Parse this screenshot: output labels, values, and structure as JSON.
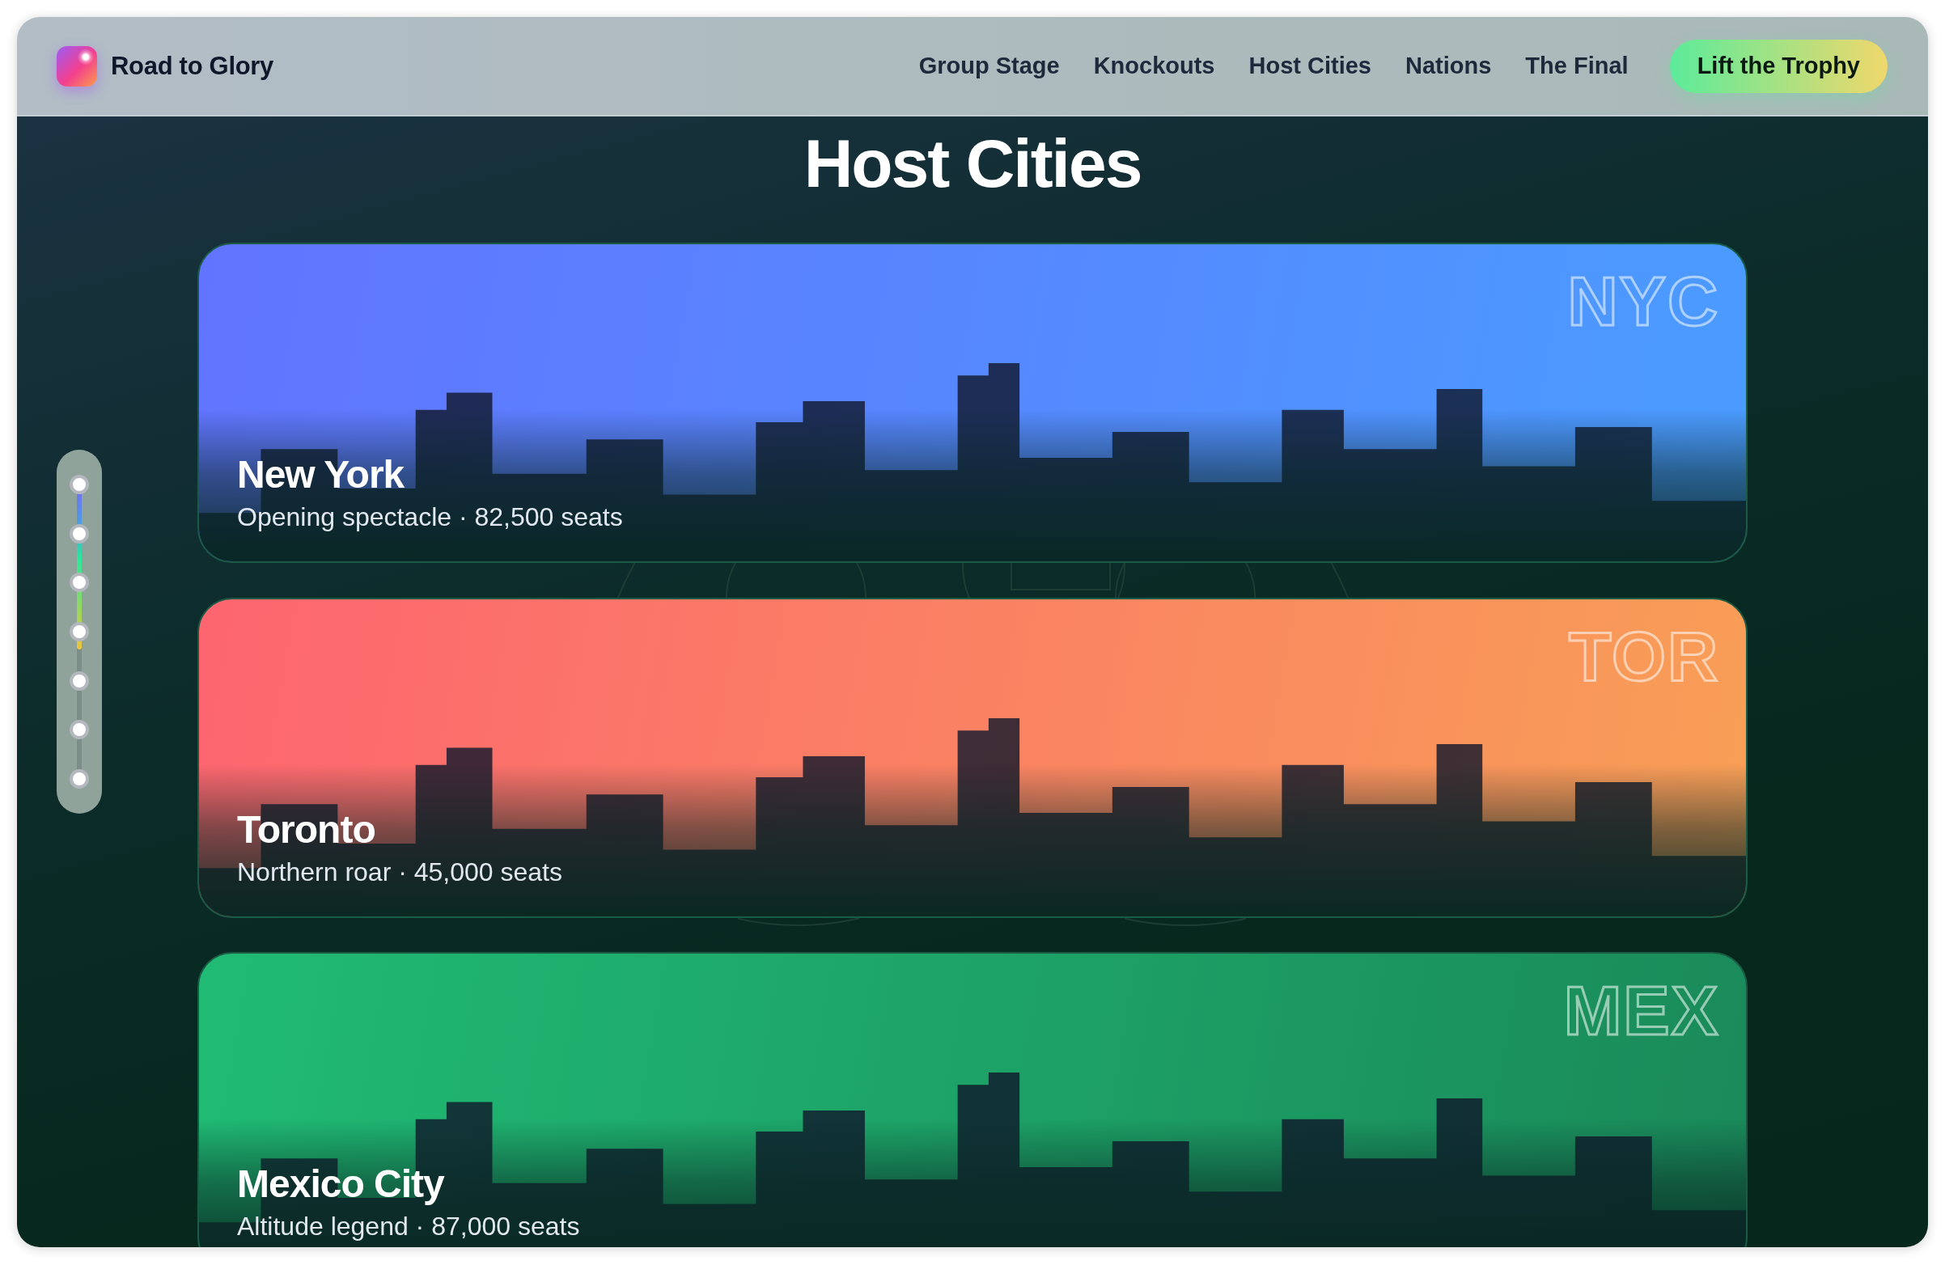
{
  "header": {
    "brand": "Road to Glory",
    "nav": [
      "Group Stage",
      "Knockouts",
      "Host Cities",
      "Nations",
      "The Final"
    ],
    "cta": "Lift the Trophy"
  },
  "title": "Host Cities",
  "progress_rail": {
    "level": 0.56
  },
  "cities": [
    {
      "name": "New York",
      "details": "Opening spectacle · 82,500 seats",
      "code": "NYC",
      "gradient": [
        {
          "color": "#6274ff"
        },
        {
          "color": "#4a9cff"
        }
      ]
    },
    {
      "name": "Toronto",
      "details": "Northern roar · 45,000 seats",
      "code": "TOR",
      "gradient": [
        {
          "color": "#fd6570"
        },
        {
          "color": "#f89f56"
        }
      ]
    },
    {
      "name": "Mexico City",
      "details": "Altitude legend · 87,000 seats",
      "code": "MEX",
      "gradient": [
        {
          "color": "#20bb74"
        },
        {
          "color": "#1a8a5a"
        }
      ]
    }
  ]
}
